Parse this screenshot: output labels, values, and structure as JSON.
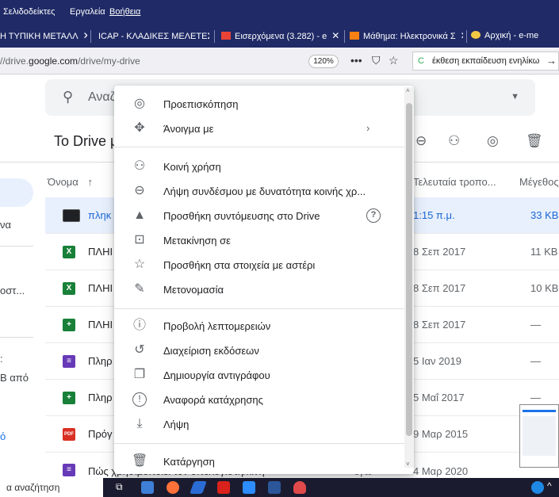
{
  "menubar": {
    "items": [
      "Σελιδοδείκτες",
      "Εργαλεία",
      "Βοήθεια"
    ]
  },
  "tabs": [
    {
      "label": "Η ΤΥΠΙΚΗ ΜΕΤΑΛΛ",
      "icon": ""
    },
    {
      "label": "ICAP - ΚΛΑΔΙΚΕΣ ΜΕΛΕΤΕΣ",
      "icon": ""
    },
    {
      "label": "Εισερχόμενα (3.282) - e",
      "icon": "gmail-icon"
    },
    {
      "label": "Μάθημα: Ηλεκτρονικά Σ",
      "icon": "moodle-icon"
    },
    {
      "label": "Αρχική - e-me",
      "icon": "eme-icon"
    }
  ],
  "url": {
    "prefix": "//drive.",
    "domain": "google.com",
    "path": "/drive/my-drive"
  },
  "zoom": "120%",
  "search2": "έκθεση εκπαίδευση ενηλίκω",
  "drive": {
    "search_placeholder": "Αναζ",
    "title": "Το Drive μ",
    "col_name": "Όνομα",
    "col_modified": "Τελευταία τροπο...",
    "col_size": "Μέγεθος",
    "rows": [
      {
        "name": "πληκ",
        "date": "1:15 π.μ.",
        "size": "33 KB",
        "type": "image",
        "color": "#202124",
        "selected": true
      },
      {
        "name": "ΠΛΗΙ",
        "date": "8 Σεπ 2017",
        "size": "11 KB",
        "type": "sheet-xls",
        "color": "#188038",
        "selected": false
      },
      {
        "name": "ΠΛΗΙ",
        "date": "8 Σεπ 2017",
        "size": "10 KB",
        "type": "sheet-xls",
        "color": "#188038",
        "selected": false
      },
      {
        "name": "ΠΛΗΙ",
        "date": "8 Σεπ 2017",
        "size": "—",
        "type": "sheet",
        "color": "#188038",
        "selected": false
      },
      {
        "name": "Πληρ",
        "date": "5 Ιαν 2019",
        "size": "—",
        "type": "form",
        "color": "#673ab7",
        "selected": false
      },
      {
        "name": "Πληρ",
        "date": "5 Μαΐ 2017",
        "size": "—",
        "type": "sheet",
        "color": "#188038",
        "selected": false
      },
      {
        "name": "Πρόγ",
        "date": "9 Μαρ 2015",
        "size": "—",
        "type": "pdf",
        "color": "#d93025",
        "selected": false
      }
    ],
    "partial_row": {
      "name": "Πώς χρησιμοποιεί τον υπολογιστή/κινη",
      "extra": "εγώ",
      "date": "4 Μαρ 2020"
    },
    "side_texts": [
      "να",
      "οστ...",
      ":",
      "Β από",
      "ό"
    ]
  },
  "context_menu": {
    "items": [
      {
        "label": "Προεπισκόπηση",
        "icon": "eye-icon",
        "glyph": "◎"
      },
      {
        "label": "Άνοιγμα με",
        "icon": "move-arrows-icon",
        "glyph": "✥",
        "submenu": true
      },
      {
        "label": "Κοινή χρήση",
        "icon": "add-person-icon",
        "glyph": "⚇"
      },
      {
        "label": "Λήψη συνδέσμου με δυνατότητα κοινής χρ...",
        "icon": "link-icon",
        "glyph": "⊖"
      },
      {
        "label": "Προσθήκη συντόμευσης στο Drive",
        "icon": "drive-shortcut-icon",
        "glyph": "▲",
        "help": true
      },
      {
        "label": "Μετακίνηση σε",
        "icon": "move-to-folder-icon",
        "glyph": "⊡"
      },
      {
        "label": "Προσθήκη στα στοιχεία με αστέρι",
        "icon": "star-icon",
        "glyph": "☆"
      },
      {
        "label": "Μετονομασία",
        "icon": "pencil-icon",
        "glyph": "✎"
      },
      {
        "label": "Προβολή λεπτομερειών",
        "icon": "info-icon",
        "glyph": "ⓘ"
      },
      {
        "label": "Διαχείριση εκδόσεων",
        "icon": "history-icon",
        "glyph": "↺"
      },
      {
        "label": "Δημιουργία αντιγράφου",
        "icon": "copy-icon",
        "glyph": "❐"
      },
      {
        "label": "Αναφορά κατάχρησης",
        "icon": "report-icon",
        "glyph": "!"
      },
      {
        "label": "Λήψη",
        "icon": "download-icon",
        "glyph": "⤓"
      },
      {
        "label": "Κατάργηση",
        "icon": "trash-icon",
        "glyph": "🗑"
      }
    ]
  },
  "taskbar": {
    "search": "α αναζήτηση"
  }
}
